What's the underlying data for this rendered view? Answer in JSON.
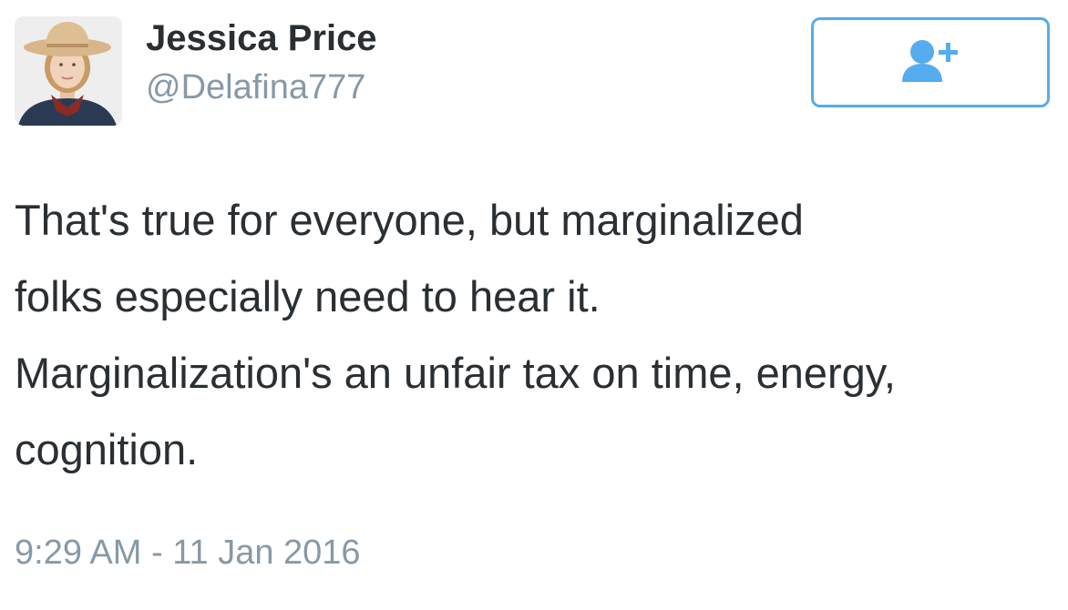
{
  "author": {
    "display_name": "Jessica Price",
    "handle": "@Delafina777"
  },
  "follow_button": {
    "icon": "add-user-icon",
    "color": "#55acee"
  },
  "tweet": {
    "lines": [
      "That's true for everyone, but marginalized",
      "folks especially need to hear it.",
      "Marginalization's an unfair tax on time, energy,",
      "cognition."
    ],
    "timestamp": "9:29 AM - 11 Jan 2016"
  },
  "colors": {
    "text": "#292f33",
    "muted": "#8899a6",
    "accent": "#55acee"
  }
}
